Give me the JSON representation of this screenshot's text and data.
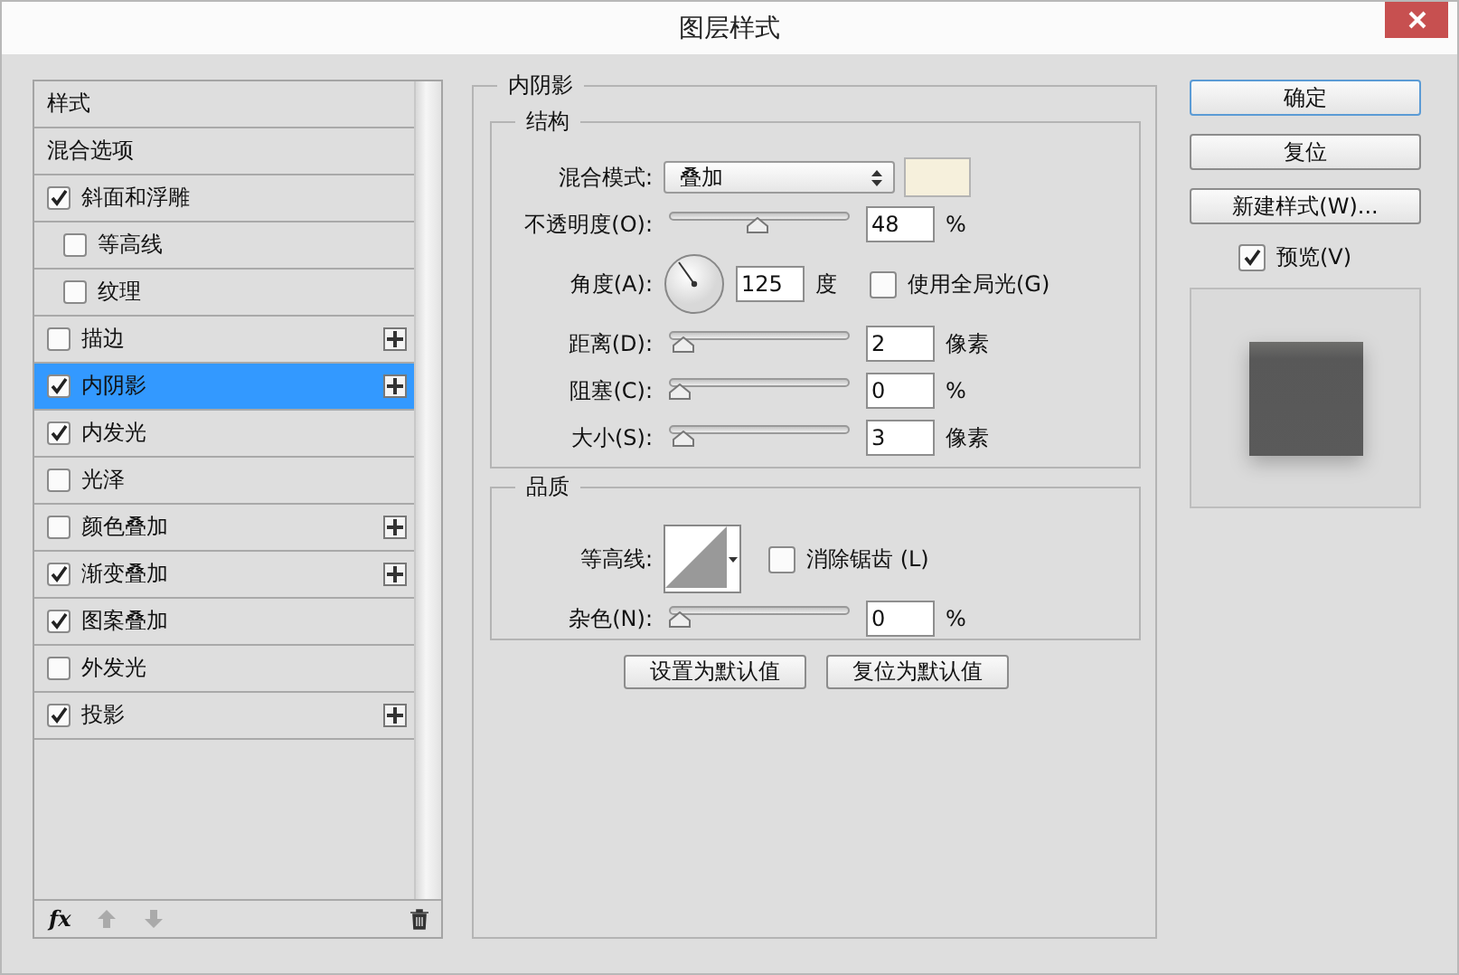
{
  "window": {
    "title": "图层样式"
  },
  "styles": {
    "items": [
      {
        "label": "样式",
        "kind": "header",
        "selected": false
      },
      {
        "label": "混合选项",
        "kind": "header",
        "selected": false
      },
      {
        "label": "斜面和浮雕",
        "kind": "effect",
        "checked": true,
        "selected": false,
        "addable": false,
        "children": [
          {
            "label": "等高线",
            "kind": "effect",
            "checked": false,
            "selected": false,
            "addable": false
          },
          {
            "label": "纹理",
            "kind": "effect",
            "checked": false,
            "selected": false,
            "addable": false
          }
        ]
      },
      {
        "label": "描边",
        "kind": "effect",
        "checked": false,
        "selected": false,
        "addable": true
      },
      {
        "label": "内阴影",
        "kind": "effect",
        "checked": true,
        "selected": true,
        "addable": true
      },
      {
        "label": "内发光",
        "kind": "effect",
        "checked": true,
        "selected": false,
        "addable": false
      },
      {
        "label": "光泽",
        "kind": "effect",
        "checked": false,
        "selected": false,
        "addable": false
      },
      {
        "label": "颜色叠加",
        "kind": "effect",
        "checked": false,
        "selected": false,
        "addable": true
      },
      {
        "label": "渐变叠加",
        "kind": "effect",
        "checked": true,
        "selected": false,
        "addable": true
      },
      {
        "label": "图案叠加",
        "kind": "effect",
        "checked": true,
        "selected": false,
        "addable": false
      },
      {
        "label": "外发光",
        "kind": "effect",
        "checked": false,
        "selected": false,
        "addable": false
      },
      {
        "label": "投影",
        "kind": "effect",
        "checked": true,
        "selected": false,
        "addable": true
      }
    ],
    "fx": "fx"
  },
  "inner_shadow": {
    "title": "内阴影",
    "structure": {
      "title": "结构",
      "rows": [
        {
          "kind": "dropdown",
          "label": "混合模式:",
          "value": "叠加"
        },
        {
          "kind": "slider",
          "label": "不透明度(O):",
          "level": 0.48,
          "value": "48",
          "unit": "%"
        },
        {
          "kind": "angle",
          "label": "角度(A):",
          "value": "125",
          "unit": "度",
          "option": {
            "label": "使用全局光(G)",
            "checked": false
          }
        },
        {
          "kind": "slider",
          "label": "距离(D):",
          "level": 0.02,
          "value": "2",
          "unit": "像素"
        },
        {
          "kind": "slider",
          "label": "阻塞(C):",
          "level": 0,
          "value": "0",
          "unit": "%"
        },
        {
          "kind": "slider",
          "label": "大小(S):",
          "level": 0.02,
          "value": "3",
          "unit": "像素"
        }
      ]
    },
    "quality": {
      "title": "品质",
      "contour": {
        "label": "等高线:"
      },
      "anti_alias": {
        "label": "消除锯齿 (L)",
        "checked": false
      },
      "noise": {
        "label": "杂色(N):",
        "level": 0,
        "value": "0",
        "unit": "%"
      }
    },
    "buttons": [
      "设置为默认值",
      "复位为默认值"
    ]
  },
  "actions": {
    "buttons": [
      {
        "label": "确定",
        "default": true
      },
      {
        "label": "复位",
        "default": false
      },
      {
        "label": "新建样式(W)...",
        "default": false
      }
    ],
    "preview": {
      "label": "预览(V)",
      "checked": true
    }
  }
}
